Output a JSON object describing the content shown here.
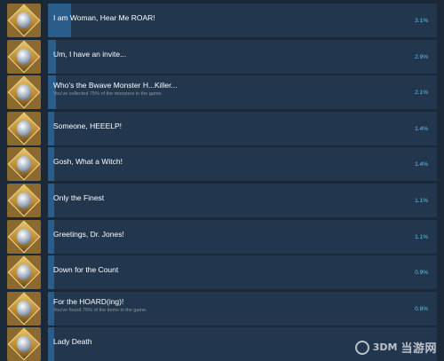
{
  "achievements": [
    {
      "title": "I am Woman, Hear Me ROAR!",
      "description": "",
      "percent": "3.1%",
      "progress": 0.06
    },
    {
      "title": "Um, I have an invite...",
      "description": "",
      "percent": "2.9%",
      "progress": 0.02
    },
    {
      "title": "Who's the Bwave Monster H...Killer...",
      "description": "You've collected 75% of the monsters in the game.",
      "percent": "2.1%",
      "progress": 0.02
    },
    {
      "title": "Someone, HEEELP!",
      "description": "",
      "percent": "1.4%",
      "progress": 0.015
    },
    {
      "title": "Gosh, What a Witch!",
      "description": "",
      "percent": "1.4%",
      "progress": 0.015
    },
    {
      "title": "Only the Finest",
      "description": "",
      "percent": "1.1%",
      "progress": 0.012
    },
    {
      "title": "Greetings, Dr. Jones!",
      "description": "",
      "percent": "1.1%",
      "progress": 0.012
    },
    {
      "title": "Down for the Count",
      "description": "",
      "percent": "0.9%",
      "progress": 0.01
    },
    {
      "title": "For the HOARD(ing)!",
      "description": "You've found 75% of the items in the game.",
      "percent": "0.8%",
      "progress": 0.009
    },
    {
      "title": "Lady Death",
      "description": "",
      "percent": "",
      "progress": 0.009
    }
  ],
  "watermark": {
    "brand": "3DM",
    "text": "当游网"
  },
  "colors": {
    "background": "#1b2838",
    "row": "#22364d",
    "bar": "#2a5d8a",
    "percent": "#66c0f4"
  }
}
